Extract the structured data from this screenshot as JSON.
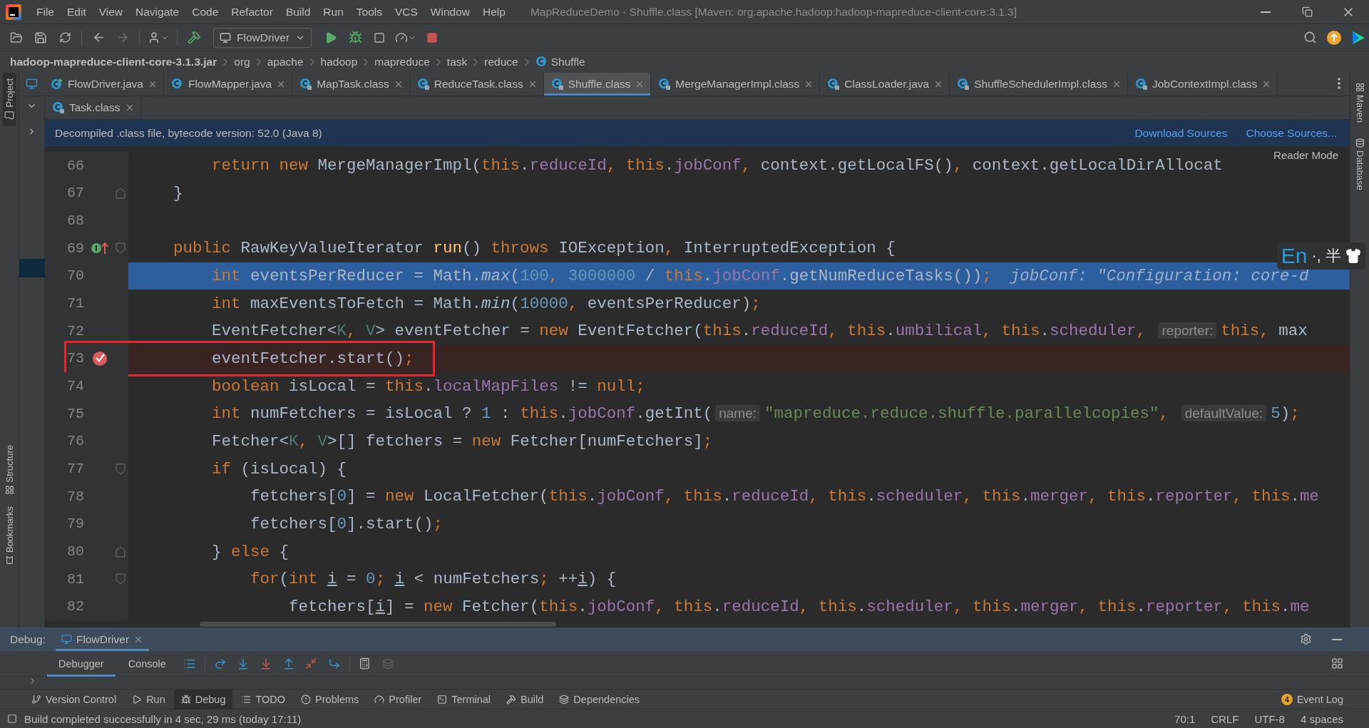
{
  "window": {
    "title": "MapReduceDemo - Shuffle.class [Maven: org.apache.hadoop:hadoop-mapreduce-client-core:3.1.3]"
  },
  "menu": [
    "File",
    "Edit",
    "View",
    "Navigate",
    "Code",
    "Refactor",
    "Build",
    "Run",
    "Tools",
    "VCS",
    "Window",
    "Help"
  ],
  "toolbar": {
    "run_config": "FlowDriver"
  },
  "breadcrumb": [
    {
      "label": "hadoop-mapreduce-client-core-3.1.3.jar",
      "kind": "jar"
    },
    {
      "label": "org",
      "kind": "package"
    },
    {
      "label": "apache",
      "kind": "package"
    },
    {
      "label": "hadoop",
      "kind": "package"
    },
    {
      "label": "mapreduce",
      "kind": "package"
    },
    {
      "label": "task",
      "kind": "package"
    },
    {
      "label": "reduce",
      "kind": "package"
    },
    {
      "label": "Shuffle",
      "kind": "class"
    }
  ],
  "tab_rows": [
    [
      {
        "label": "FlowDriver.java",
        "kind": "java-run",
        "selected": false
      },
      {
        "label": "FlowMapper.java",
        "kind": "java",
        "selected": false
      },
      {
        "label": "MapTask.class",
        "kind": "class",
        "selected": false
      },
      {
        "label": "ReduceTask.class",
        "kind": "class",
        "selected": false
      },
      {
        "label": "Shuffle.class",
        "kind": "class",
        "selected": true
      },
      {
        "label": "MergeManagerImpl.class",
        "kind": "class",
        "selected": false
      },
      {
        "label": "ClassLoader.java",
        "kind": "class",
        "selected": false
      },
      {
        "label": "ShuffleSchedulerImpl.class",
        "kind": "class",
        "selected": false
      },
      {
        "label": "JobContextImpl.class",
        "kind": "class",
        "selected": false
      }
    ],
    [
      {
        "label": "Task.class",
        "kind": "class",
        "selected": false
      }
    ]
  ],
  "banner": {
    "text": "Decompiled .class file, bytecode version: 52.0 (Java 8)",
    "links": [
      "Download Sources",
      "Choose Sources..."
    ]
  },
  "reader_mode": "Reader Mode",
  "editor": {
    "lines": [
      {
        "number": "66",
        "tokens": [
          {
            "kind": "kw",
            "text": "        return new"
          },
          {
            "kind": "p",
            "text": " MergeManagerImpl("
          },
          {
            "kind": "kw",
            "text": "this"
          },
          {
            "kind": "p",
            "text": "."
          },
          {
            "kind": "field",
            "text": "reduceId"
          },
          {
            "kind": "p",
            "text": ", "
          },
          {
            "kind": "kw",
            "text": "this"
          },
          {
            "kind": "p",
            "text": "."
          },
          {
            "kind": "field",
            "text": "jobConf"
          },
          {
            "kind": "p",
            "text": ", context.getLocalFS(), context.getLocalDirAllocat"
          }
        ]
      },
      {
        "number": "67",
        "fold_end": true,
        "tokens": [
          {
            "kind": "p",
            "text": "    }"
          }
        ]
      },
      {
        "number": "68"
      },
      {
        "number": "69",
        "implements_marker": true,
        "fold_start": true,
        "tokens": [
          {
            "kind": "kw",
            "text": "    public"
          },
          {
            "kind": "p",
            "text": " RawKeyValueIterator "
          },
          {
            "kind": "decl",
            "text": "run"
          },
          {
            "kind": "p",
            "text": "() "
          },
          {
            "kind": "kw",
            "text": "throws"
          },
          {
            "kind": "p",
            "text": " IOException, InterruptedException {"
          }
        ]
      },
      {
        "number": "70",
        "execution_point": true,
        "tokens": [
          {
            "kind": "kw",
            "text": "        int"
          },
          {
            "kind": "p",
            "text": " eventsPerReducer = Math."
          },
          {
            "kind": "static",
            "text": "max"
          },
          {
            "kind": "p",
            "text": "("
          },
          {
            "kind": "num",
            "text": "100"
          },
          {
            "kind": "p",
            "text": ", "
          },
          {
            "kind": "num",
            "text": "3000000"
          },
          {
            "kind": "p",
            "text": " / "
          },
          {
            "kind": "kw",
            "text": "this"
          },
          {
            "kind": "p",
            "text": "."
          },
          {
            "kind": "field",
            "text": "jobConf"
          },
          {
            "kind": "p",
            "text": ".getNumReduceTasks());"
          },
          {
            "kind": "inlay",
            "text": "jobConf: \"Configuration: core-d"
          }
        ]
      },
      {
        "number": "71",
        "tokens": [
          {
            "kind": "kw",
            "text": "        int"
          },
          {
            "kind": "p",
            "text": " maxEventsToFetch = Math."
          },
          {
            "kind": "static",
            "text": "min"
          },
          {
            "kind": "p",
            "text": "("
          },
          {
            "kind": "num",
            "text": "10000"
          },
          {
            "kind": "p",
            "text": ", eventsPerReducer);"
          }
        ]
      },
      {
        "number": "72",
        "tokens": [
          {
            "kind": "p",
            "text": "        EventFetcher<"
          },
          {
            "kind": "tp",
            "text": "K"
          },
          {
            "kind": "p",
            "text": ", "
          },
          {
            "kind": "tp",
            "text": "V"
          },
          {
            "kind": "p",
            "text": "> eventFetcher = "
          },
          {
            "kind": "kw",
            "text": "new"
          },
          {
            "kind": "p",
            "text": " EventFetcher("
          },
          {
            "kind": "kw",
            "text": "this"
          },
          {
            "kind": "p",
            "text": "."
          },
          {
            "kind": "field",
            "text": "reduceId"
          },
          {
            "kind": "p",
            "text": ", "
          },
          {
            "kind": "kw",
            "text": "this"
          },
          {
            "kind": "p",
            "text": "."
          },
          {
            "kind": "field",
            "text": "umbilical"
          },
          {
            "kind": "p",
            "text": ", "
          },
          {
            "kind": "kw",
            "text": "this"
          },
          {
            "kind": "p",
            "text": "."
          },
          {
            "kind": "field",
            "text": "scheduler"
          },
          {
            "kind": "p",
            "text": ", "
          },
          {
            "kind": "hint",
            "text": "reporter:"
          },
          {
            "kind": "kw",
            "text": "this"
          },
          {
            "kind": "p",
            "text": ", max"
          }
        ]
      },
      {
        "number": "73",
        "breakpoint": true,
        "outlined": true,
        "tokens": [
          {
            "kind": "p",
            "text": "        eventFetcher.start();"
          }
        ]
      },
      {
        "number": "74",
        "tokens": [
          {
            "kind": "kw",
            "text": "        boolean"
          },
          {
            "kind": "p",
            "text": " isLocal = "
          },
          {
            "kind": "kw",
            "text": "this"
          },
          {
            "kind": "p",
            "text": "."
          },
          {
            "kind": "field",
            "text": "localMapFiles"
          },
          {
            "kind": "p",
            "text": " != "
          },
          {
            "kind": "kw",
            "text": "null"
          },
          {
            "kind": "p",
            "text": ";"
          }
        ]
      },
      {
        "number": "75",
        "tokens": [
          {
            "kind": "kw",
            "text": "        int"
          },
          {
            "kind": "p",
            "text": " numFetchers = isLocal ? "
          },
          {
            "kind": "num",
            "text": "1"
          },
          {
            "kind": "p",
            "text": " : "
          },
          {
            "kind": "kw",
            "text": "this"
          },
          {
            "kind": "p",
            "text": "."
          },
          {
            "kind": "field",
            "text": "jobConf"
          },
          {
            "kind": "p",
            "text": ".getInt("
          },
          {
            "kind": "hint",
            "text": "name:"
          },
          {
            "kind": "str",
            "text": "\"mapreduce.reduce.shuffle.parallelcopies\""
          },
          {
            "kind": "p",
            "text": ", "
          },
          {
            "kind": "hint",
            "text": "defaultValue:"
          },
          {
            "kind": "num",
            "text": "5"
          },
          {
            "kind": "p",
            "text": ");"
          }
        ]
      },
      {
        "number": "76",
        "tokens": [
          {
            "kind": "p",
            "text": "        Fetcher<"
          },
          {
            "kind": "tp",
            "text": "K"
          },
          {
            "kind": "p",
            "text": ", "
          },
          {
            "kind": "tp",
            "text": "V"
          },
          {
            "kind": "p",
            "text": ">[] fetchers = "
          },
          {
            "kind": "kw",
            "text": "new"
          },
          {
            "kind": "p",
            "text": " Fetcher[numFetchers];"
          }
        ]
      },
      {
        "number": "77",
        "fold_start": true,
        "tokens": [
          {
            "kind": "kw",
            "text": "        if"
          },
          {
            "kind": "p",
            "text": " (isLocal) {"
          }
        ]
      },
      {
        "number": "78",
        "tokens": [
          {
            "kind": "p",
            "text": "            fetchers["
          },
          {
            "kind": "num",
            "text": "0"
          },
          {
            "kind": "p",
            "text": "] = "
          },
          {
            "kind": "kw",
            "text": "new"
          },
          {
            "kind": "p",
            "text": " LocalFetcher("
          },
          {
            "kind": "kw",
            "text": "this"
          },
          {
            "kind": "p",
            "text": "."
          },
          {
            "kind": "field",
            "text": "jobConf"
          },
          {
            "kind": "p",
            "text": ", "
          },
          {
            "kind": "kw",
            "text": "this"
          },
          {
            "kind": "p",
            "text": "."
          },
          {
            "kind": "field",
            "text": "reduceId"
          },
          {
            "kind": "p",
            "text": ", "
          },
          {
            "kind": "kw",
            "text": "this"
          },
          {
            "kind": "p",
            "text": "."
          },
          {
            "kind": "field",
            "text": "scheduler"
          },
          {
            "kind": "p",
            "text": ", "
          },
          {
            "kind": "kw",
            "text": "this"
          },
          {
            "kind": "p",
            "text": "."
          },
          {
            "kind": "field",
            "text": "merger"
          },
          {
            "kind": "p",
            "text": ", "
          },
          {
            "kind": "kw",
            "text": "this"
          },
          {
            "kind": "p",
            "text": "."
          },
          {
            "kind": "field",
            "text": "reporter"
          },
          {
            "kind": "p",
            "text": ", "
          },
          {
            "kind": "kw",
            "text": "this"
          },
          {
            "kind": "p",
            "text": "."
          },
          {
            "kind": "field",
            "text": "me"
          }
        ]
      },
      {
        "number": "79",
        "tokens": [
          {
            "kind": "p",
            "text": "            fetchers["
          },
          {
            "kind": "num",
            "text": "0"
          },
          {
            "kind": "p",
            "text": "].start();"
          }
        ]
      },
      {
        "number": "80",
        "fold_end": true,
        "tokens": [
          {
            "kind": "p",
            "text": "        } "
          },
          {
            "kind": "kw",
            "text": "else"
          },
          {
            "kind": "p",
            "text": " {"
          }
        ]
      },
      {
        "number": "81",
        "fold_start": true,
        "tokens": [
          {
            "kind": "kw",
            "text": "            for"
          },
          {
            "kind": "p",
            "text": "("
          },
          {
            "kind": "kw",
            "text": "int "
          },
          {
            "kind": "u",
            "text": "i"
          },
          {
            "kind": "p",
            "text": " = "
          },
          {
            "kind": "num",
            "text": "0"
          },
          {
            "kind": "p",
            "text": "; "
          },
          {
            "kind": "u",
            "text": "i"
          },
          {
            "kind": "p",
            "text": " < numFetchers; ++"
          },
          {
            "kind": "u",
            "text": "i"
          },
          {
            "kind": "p",
            "text": ") {"
          }
        ]
      },
      {
        "number": "82",
        "tokens": [
          {
            "kind": "p",
            "text": "                fetchers["
          },
          {
            "kind": "u",
            "text": "i"
          },
          {
            "kind": "p",
            "text": "] = "
          },
          {
            "kind": "kw",
            "text": "new"
          },
          {
            "kind": "p",
            "text": " Fetcher("
          },
          {
            "kind": "kw",
            "text": "this"
          },
          {
            "kind": "p",
            "text": "."
          },
          {
            "kind": "field",
            "text": "jobConf"
          },
          {
            "kind": "p",
            "text": ", "
          },
          {
            "kind": "kw",
            "text": "this"
          },
          {
            "kind": "p",
            "text": "."
          },
          {
            "kind": "field",
            "text": "reduceId"
          },
          {
            "kind": "p",
            "text": ", "
          },
          {
            "kind": "kw",
            "text": "this"
          },
          {
            "kind": "p",
            "text": "."
          },
          {
            "kind": "field",
            "text": "scheduler"
          },
          {
            "kind": "p",
            "text": ", "
          },
          {
            "kind": "kw",
            "text": "this"
          },
          {
            "kind": "p",
            "text": "."
          },
          {
            "kind": "field",
            "text": "merger"
          },
          {
            "kind": "p",
            "text": ", "
          },
          {
            "kind": "kw",
            "text": "this"
          },
          {
            "kind": "p",
            "text": "."
          },
          {
            "kind": "field",
            "text": "reporter"
          },
          {
            "kind": "p",
            "text": ", "
          },
          {
            "kind": "kw",
            "text": "this"
          },
          {
            "kind": "p",
            "text": "."
          },
          {
            "kind": "field",
            "text": "me"
          }
        ]
      }
    ]
  },
  "ime_toolbar": {
    "language": "En",
    "punctuation": "·,",
    "width_mode": "半"
  },
  "left_stripe": [
    "Project",
    "Structure",
    "Bookmarks"
  ],
  "right_stripe": [
    "Maven",
    "Database"
  ],
  "debug": {
    "label": "Debug:",
    "session": "FlowDriver",
    "subtabs": [
      {
        "label": "Debugger",
        "selected": true
      },
      {
        "label": "Console",
        "selected": false
      }
    ]
  },
  "tool_windows": [
    {
      "label": "Version Control",
      "selected": false
    },
    {
      "label": "Run",
      "selected": false
    },
    {
      "label": "Debug",
      "selected": true
    },
    {
      "label": "TODO",
      "selected": false
    },
    {
      "label": "Problems",
      "selected": false
    },
    {
      "label": "Profiler",
      "selected": false
    },
    {
      "label": "Terminal",
      "selected": false
    },
    {
      "label": "Build",
      "selected": false
    },
    {
      "label": "Dependencies",
      "selected": false
    }
  ],
  "event_log": {
    "count": "4",
    "label": "Event Log"
  },
  "status_bar": {
    "message": "Build completed successfully in 4 sec, 29 ms (today 17:11)",
    "items": [
      "70:1",
      "CRLF",
      "UTF-8",
      "4 spaces"
    ]
  }
}
